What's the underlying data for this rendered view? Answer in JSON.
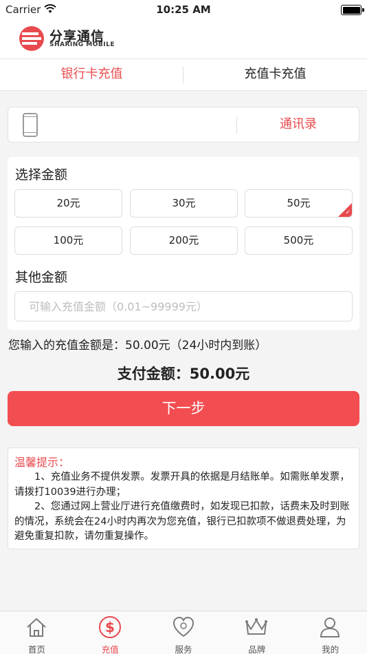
{
  "status_bar": {
    "carrier": "Carrier",
    "time": "10:25 AM"
  },
  "brand": {
    "name_cn": "分享通信",
    "name_en": "SHARING MOBILE",
    "accent_color": "#e84a4e"
  },
  "tabs": [
    {
      "label": "银行卡充值",
      "active": true
    },
    {
      "label": "充值卡充值",
      "active": false
    }
  ],
  "phone": {
    "value": "",
    "placeholder": "",
    "contacts_label": "通讯录"
  },
  "amount": {
    "title": "选择金额",
    "options": [
      {
        "label": "20元",
        "selected": false
      },
      {
        "label": "30元",
        "selected": false
      },
      {
        "label": "50元",
        "selected": true
      },
      {
        "label": "100元",
        "selected": false
      },
      {
        "label": "200元",
        "selected": false
      },
      {
        "label": "500元",
        "selected": false
      }
    ],
    "other_title": "其他金额",
    "other_placeholder": "可输入充值金额（0.01~99999元）"
  },
  "summary": {
    "entered_text": "您输入的充值金额是：50.00元（24小时内到账）",
    "pay_text": "支付金额：50.00元"
  },
  "next_button": "下一步",
  "tips": {
    "title": "温馨提示：",
    "body": "　　1、充值业务不提供发票。发票开具的依据是月结账单。如需账单发票，请拨打10039进行办理；\n　　2、您通过网上营业厅进行充值缴费时，如发现已扣款，话费未及时到账的情况，系统会在24小时内再次为您充值，银行已扣款项不做退费处理，为避免重复扣款，请勿重复操作。"
  },
  "tabbar": [
    {
      "label": "首页",
      "icon": "home-icon",
      "active": false
    },
    {
      "label": "充值",
      "icon": "dollar-circle-icon",
      "active": true
    },
    {
      "label": "服务",
      "icon": "heart-service-icon",
      "active": false
    },
    {
      "label": "品牌",
      "icon": "crown-icon",
      "active": false
    },
    {
      "label": "我的",
      "icon": "user-icon",
      "active": false
    }
  ]
}
